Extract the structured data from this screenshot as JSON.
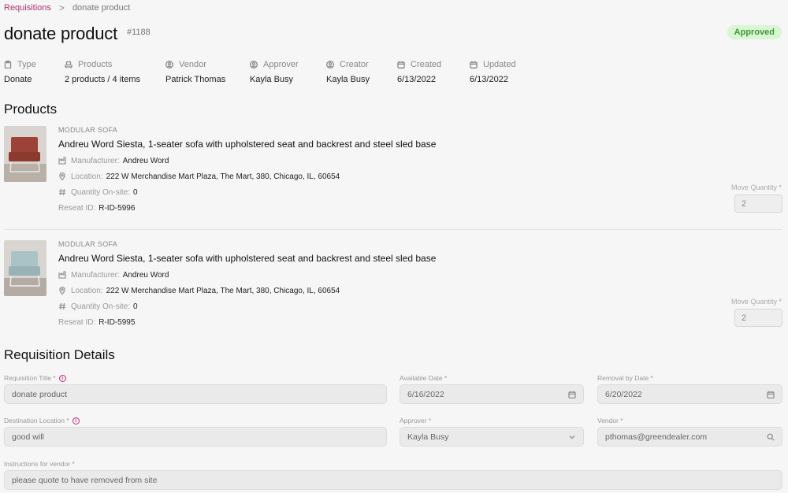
{
  "breadcrumb": {
    "parent": "Requisitions",
    "separator": ">",
    "current": "donate product"
  },
  "header": {
    "title": "donate product",
    "number": "#1188",
    "status": "Approved"
  },
  "meta": [
    {
      "label": "Type",
      "value": "Donate",
      "icon": "clipboard-icon"
    },
    {
      "label": "Products",
      "value": "2 products / 4 items",
      "icon": "sofa-icon"
    },
    {
      "label": "Vendor",
      "value": "Patrick Thomas",
      "icon": "user-icon"
    },
    {
      "label": "Approver",
      "value": "Kayla Busy",
      "icon": "user-icon"
    },
    {
      "label": "Creator",
      "value": "Kayla Busy",
      "icon": "user-icon"
    },
    {
      "label": "Created",
      "value": "6/13/2022",
      "icon": "calendar-icon"
    },
    {
      "label": "Updated",
      "value": "6/13/2022",
      "icon": "calendar-icon"
    }
  ],
  "products_section": {
    "title": "Products"
  },
  "products": [
    {
      "category": "MODULAR SOFA",
      "name": "Andreu Word Siesta, 1-seater sofa with upholstered seat and backrest and steel sled base",
      "manufacturer_label": "Manufacturer:",
      "manufacturer": "Andreu Word",
      "location_label": "Location:",
      "location": "222 W Merchandise Mart Plaza, The Mart, 380, Chicago, IL, 60654",
      "quantity_label": "Quantity On-site:",
      "quantity": "0",
      "reseat_label": "Reseat ID:",
      "reseat_id": "R-ID-5996",
      "move_quantity_label": "Move Quantity *",
      "move_quantity": "2",
      "color": "#9c4236"
    },
    {
      "category": "MODULAR SOFA",
      "name": "Andreu Word Siesta, 1-seater sofa with upholstered seat and backrest and steel sled base",
      "manufacturer_label": "Manufacturer:",
      "manufacturer": "Andreu Word",
      "location_label": "Location:",
      "location": "222 W Merchandise Mart Plaza, The Mart, 380, Chicago, IL, 60654",
      "quantity_label": "Quantity On-site:",
      "quantity": "0",
      "reseat_label": "Reseat ID:",
      "reseat_id": "R-ID-5995",
      "move_quantity_label": "Move Quantity *",
      "move_quantity": "2",
      "color": "#a9c3c6"
    }
  ],
  "details_section": {
    "title": "Requisition Details"
  },
  "form": {
    "title_label": "Requisition Title *",
    "title_value": "donate product",
    "available_date_label": "Available Date *",
    "available_date": "6/16/2022",
    "removal_date_label": "Removal by Date *",
    "removal_date": "6/20/2022",
    "destination_label": "Destination Location *",
    "destination_value": "good will",
    "approver_label": "Approver *",
    "approver_value": "Kayla Busy",
    "vendor_label": "Vendor *",
    "vendor_value": "pthomas@greendealer.com",
    "instructions_label": "Instructions for vendor *",
    "instructions_value": "please quote to have removed from site"
  },
  "colors": {
    "accent": "#b0336a",
    "status_bg": "#d9f5d4",
    "status_text": "#3d9a34"
  }
}
